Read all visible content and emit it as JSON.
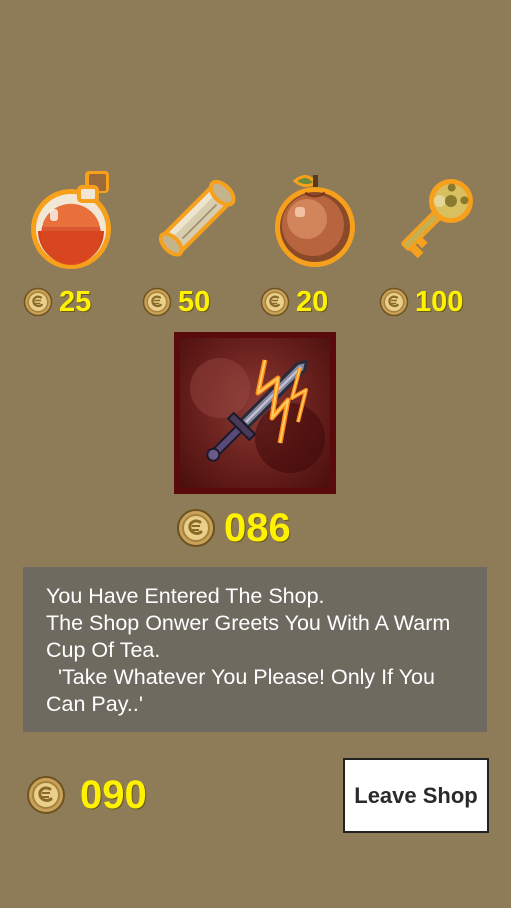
{
  "shop": {
    "items": [
      {
        "icon": "potion-icon",
        "price": "25"
      },
      {
        "icon": "scroll-icon",
        "price": "50"
      },
      {
        "icon": "apple-icon",
        "price": "20"
      },
      {
        "icon": "key-icon",
        "price": "100"
      }
    ],
    "featured": {
      "icon": "cursed-sword-icon",
      "price": "086"
    }
  },
  "dialog": {
    "lines": [
      "You Have Entered The Shop.",
      "The Shop Onwer Greets You With A Warm Cup Of Tea.",
      "  'Take Whatever You Please! Only If You Can Pay..'"
    ]
  },
  "player": {
    "coins": "090"
  },
  "buttons": {
    "leave_label": "Leave Shop"
  },
  "colors": {
    "background": "#8e7b57",
    "price_text": "#fff200",
    "dialog_bg": "#6e6a60",
    "featured_border": "#5a0a0a"
  }
}
